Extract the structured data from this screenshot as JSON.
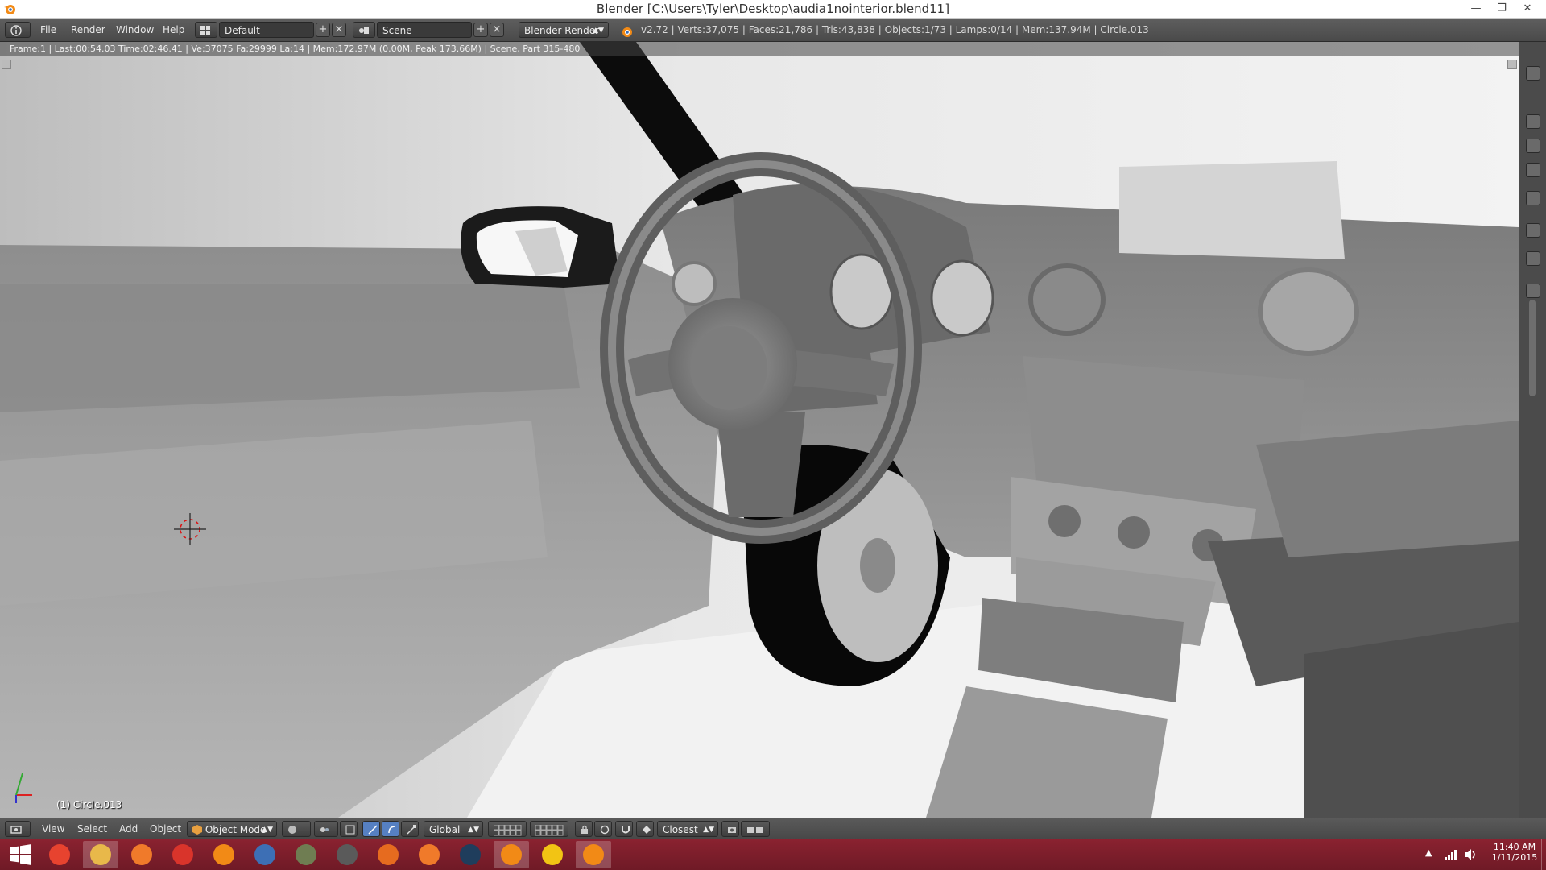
{
  "window": {
    "title": "Blender [C:\\Users\\Tyler\\Desktop\\audia1nointerior.blend11]"
  },
  "menubar": {
    "menus": [
      "File",
      "Render",
      "Window",
      "Help"
    ],
    "screen_layout": "Default",
    "scene": "Scene",
    "render_engine": "Blender Render",
    "stats": "v2.72 | Verts:37,075 | Faces:21,786 | Tris:43,838 | Objects:1/73 | Lamps:0/14 | Mem:137.94M | Circle.013"
  },
  "viewport": {
    "render_info": "Frame:1 | Last:00:54.03 Time:02:46.41 | Ve:37075 Fa:29999 La:14 | Mem:172.97M (0.00M, Peak 173.66M) | Scene, Part 315-480",
    "object_label": "(1) Circle.013"
  },
  "footer": {
    "menus": [
      "View",
      "Select",
      "Add",
      "Object"
    ],
    "mode": "Object Mode",
    "orientation": "Global",
    "snap_target": "Closest"
  },
  "taskbar": {
    "time": "11:40 AM",
    "date": "1/11/2015",
    "apps": [
      {
        "icon": "chrome-icon",
        "color": "#e7432f"
      },
      {
        "icon": "file-explorer-icon",
        "color": "#e8b84a"
      },
      {
        "icon": "origin-icon",
        "color": "#f07a2a"
      },
      {
        "icon": "sketchup-icon",
        "color": "#d9342b"
      },
      {
        "icon": "blender-icon",
        "color": "#f28a16"
      },
      {
        "icon": "game-controller-icon",
        "color": "#3d6fb5"
      },
      {
        "icon": "racing-game-icon",
        "color": "#6f7d52"
      },
      {
        "icon": "arcade-game-icon",
        "color": "#5a5a5a"
      },
      {
        "icon": "firefox-icon",
        "color": "#e66b1f"
      },
      {
        "icon": "origin-icon",
        "color": "#f07a2a"
      },
      {
        "icon": "steam-icon",
        "color": "#1f3d5c"
      },
      {
        "icon": "blender-icon",
        "color": "#f28a16"
      },
      {
        "icon": "norton-icon",
        "color": "#f2c414"
      },
      {
        "icon": "blender-icon",
        "color": "#f28a16"
      }
    ],
    "active_indices": [
      1,
      11,
      13
    ]
  },
  "colors": {
    "accent_blue": "#5680c2",
    "taskbar": "#7a1e2b",
    "blender_orange": "#f28a16"
  }
}
